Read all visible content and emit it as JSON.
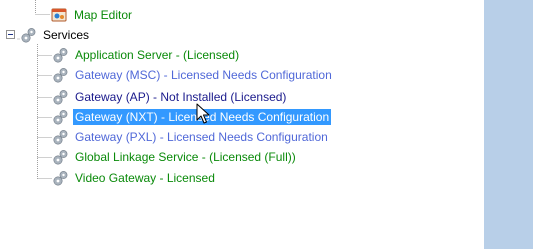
{
  "colors": {
    "licensed_green": "#0a8a0a",
    "config_blue": "#5068d8",
    "not_installed_navy": "#1a1a8c",
    "selection_bg": "#3399ff",
    "side_panel": "#b8cfe8",
    "tree_line": "#a0a0a0"
  },
  "tree": {
    "map_editor": {
      "label": "Map Editor",
      "icon": "map-editor-icon"
    },
    "services": {
      "label": "Services",
      "icon": "gears-icon",
      "expanded": true,
      "items": [
        {
          "label": "Application Server - (Licensed)",
          "status": "licensed",
          "icon": "gear-icon"
        },
        {
          "label": "Gateway (MSC) - Licensed Needs Configuration",
          "status": "needs-config",
          "icon": "gear-icon"
        },
        {
          "label": "Gateway (AP) - Not Installed (Licensed)",
          "status": "not-installed",
          "icon": "gear-icon"
        },
        {
          "label": "Gateway (NXT) - Licensed Needs Configuration",
          "status": "needs-config",
          "icon": "gear-icon",
          "selected": true
        },
        {
          "label": "Gateway (PXL) - Licensed Needs Configuration",
          "status": "needs-config",
          "icon": "gear-icon"
        },
        {
          "label": "Global Linkage Service - (Licensed (Full))",
          "status": "licensed",
          "icon": "gear-icon"
        },
        {
          "label": "Video Gateway - Licensed",
          "status": "licensed",
          "icon": "gear-icon"
        }
      ]
    }
  }
}
